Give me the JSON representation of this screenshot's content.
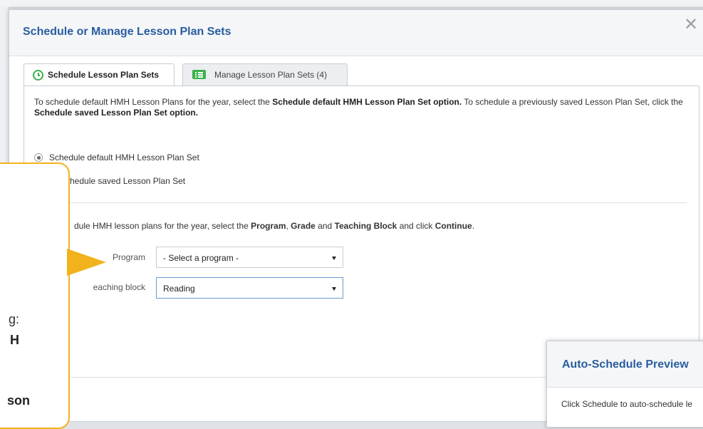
{
  "modal": {
    "title": "Schedule or Manage Lesson Plan Sets",
    "close_label": "✕"
  },
  "tabs": [
    {
      "label": "Schedule Lesson Plan Sets",
      "icon": "clock-icon",
      "active": true
    },
    {
      "label": "Manage Lesson Plan Sets (4)",
      "icon": "list-icon",
      "active": false
    }
  ],
  "intro": {
    "part1": "To schedule default HMH Lesson Plans for the year, select the ",
    "bold1": "Schedule default HMH Lesson Plan Set option.",
    "part2": " To schedule a previously saved Lesson Plan Set, click the ",
    "bold2": "Schedule saved Lesson Plan Set option."
  },
  "options": [
    {
      "label": "Schedule default HMH Lesson Plan Set",
      "checked": true
    },
    {
      "label": "hedule saved Lesson Plan Set",
      "checked": false
    }
  ],
  "instruction2": {
    "part1": "dule HMH lesson plans for the year, select the ",
    "program": "Program",
    "sep1": ", ",
    "grade": "Grade",
    "sep2": " and ",
    "teaching_block": "Teaching Block",
    "part2": " and click ",
    "continue": "Continue",
    "end": "."
  },
  "fields": {
    "program_label": "Program",
    "program_value": "- Select a program -",
    "teaching_block_label": "eaching block",
    "teaching_block_value": "Reading"
  },
  "callout": {
    "line1": "g:",
    "line2": "H",
    "line3": "son"
  },
  "preview": {
    "title": "Auto-Schedule Preview",
    "text": "Click Schedule to auto-schedule le"
  },
  "colors": {
    "title_blue": "#2a5d9e",
    "accent_green": "#3bb14a",
    "callout_orange": "#f2b21b"
  }
}
